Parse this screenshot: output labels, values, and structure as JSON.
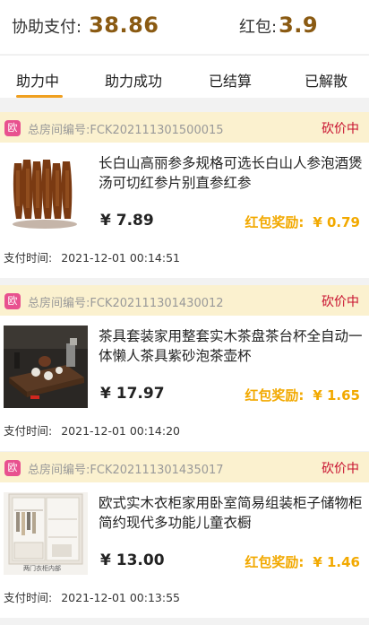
{
  "summary": {
    "assist_pay_label": "协助支付",
    "assist_pay_value": "38.86",
    "red_packet_label": "红包",
    "red_packet_value": "3.9",
    "colon": ":"
  },
  "tabs": [
    {
      "label": "助力中",
      "active": true
    },
    {
      "label": "助力成功",
      "active": false
    },
    {
      "label": "已结算",
      "active": false
    },
    {
      "label": "已解散",
      "active": false
    }
  ],
  "colors": {
    "accent": "#f0a020",
    "status": "#c8102e",
    "reward": "#f2a900",
    "header_bg": "#fbf1cf",
    "badge": "#e8518f"
  },
  "orders": [
    {
      "badge_icon": "shop-badge-icon",
      "badge_text": "欧",
      "room_no": "总房间编号:FCK202111301500015",
      "status": "砍价中",
      "title": "长白山高丽参多规格可选长白山人参泡酒煲汤可切红参片别直参红参",
      "price": "¥ 7.89",
      "reward_label": "红包奖励:",
      "reward_value": "¥ 0.79",
      "pay_label": "支付时间:",
      "pay_time": "2021-12-01 00:14:51"
    },
    {
      "badge_icon": "shop-badge-icon",
      "badge_text": "欧",
      "room_no": "总房间编号:FCK202111301430012",
      "status": "砍价中",
      "title": "茶具套装家用整套实木茶盘茶台杯全自动一体懒人茶具紫砂泡茶壶杯",
      "price": "¥ 17.97",
      "reward_label": "红包奖励:",
      "reward_value": "¥ 1.65",
      "pay_label": "支付时间:",
      "pay_time": "2021-12-01 00:14:20"
    },
    {
      "badge_icon": "shop-badge-icon",
      "badge_text": "欧",
      "room_no": "总房间编号:FCK202111301435017",
      "status": "砍价中",
      "title": "欧式实木衣柜家用卧室简易组装柜子储物柜简约现代多功能儿童衣橱",
      "price": "¥ 13.00",
      "reward_label": "红包奖励:",
      "reward_value": "¥ 1.46",
      "pay_label": "支付时间:",
      "pay_time": "2021-12-01 00:13:55",
      "image_caption": "两门衣柜内部"
    }
  ]
}
